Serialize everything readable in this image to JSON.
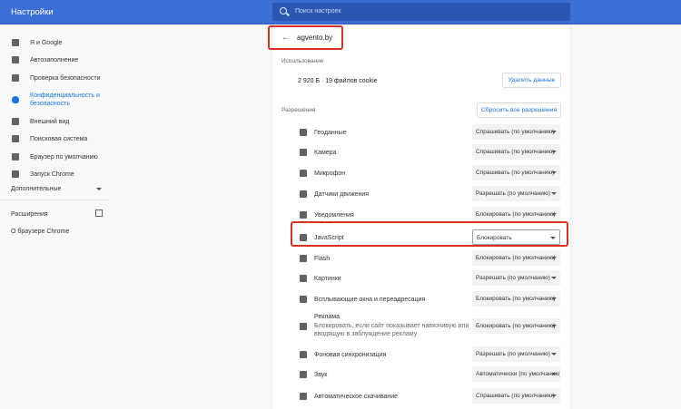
{
  "header": {
    "title": "Настройки",
    "search_placeholder": "Поиск настроек"
  },
  "sidebar": {
    "items": [
      {
        "label": "Я и Google",
        "icon": "person-icon"
      },
      {
        "label": "Автозаполнение",
        "icon": "clipboard-icon"
      },
      {
        "label": "Проверка безопасности",
        "icon": "shield-check-icon"
      },
      {
        "label": "Конфиденциальность и безопасность",
        "icon": "shield-icon",
        "active": true
      },
      {
        "label": "Внешний вид",
        "icon": "palette-icon"
      },
      {
        "label": "Поисковая система",
        "icon": "search-icon"
      },
      {
        "label": "Браузер по умолчанию",
        "icon": "browser-icon"
      },
      {
        "label": "Запуск Chrome",
        "icon": "power-icon"
      }
    ],
    "advanced": "Дополнительные",
    "extensions": "Расширения",
    "about": "О браузере Chrome"
  },
  "site": {
    "name": "agvento.by",
    "usage_heading": "Использование",
    "usage": "2 920 Б · 19 файлов cookie",
    "clear_button": "Удалить данные",
    "permissions_heading": "Разрешения",
    "reset_button": "Сбросить все разрешения"
  },
  "permissions": [
    {
      "label": "Геоданные",
      "value": "Спрашивать (по умолчанию)",
      "icon": "location-icon"
    },
    {
      "label": "Камера",
      "value": "Спрашивать (по умолчанию)",
      "icon": "camera-icon"
    },
    {
      "label": "Микрофон",
      "value": "Спрашивать (по умолчанию)",
      "icon": "microphone-icon"
    },
    {
      "label": "Датчики движения",
      "value": "Разрешать (по умолчанию)",
      "icon": "sensors-icon"
    },
    {
      "label": "Уведомления",
      "value": "Блокировать (по умолчанию)",
      "icon": "bell-icon"
    },
    {
      "label": "JavaScript",
      "value": "Блокировать",
      "icon": "code-icon"
    },
    {
      "label": "Flash",
      "value": "Блокировать (по умолчанию)",
      "icon": "puzzle-icon"
    },
    {
      "label": "Картинки",
      "value": "Разрешать (по умолчанию)",
      "icon": "image-icon"
    },
    {
      "label": "Всплывающие окна и переадресация",
      "value": "Блокировать (по умолчанию)",
      "icon": "popup-icon"
    },
    {
      "label": "Реклама",
      "sub": "Блокировать, если сайт показывает навязчивую или вводящую в заблуждение рекламу",
      "value": "Блокировать (по умолчанию)",
      "icon": "ads-icon"
    },
    {
      "label": "Фоновая синхронизация",
      "value": "Разрешать (по умолчанию)",
      "icon": "sync-icon"
    },
    {
      "label": "Звук",
      "value": "Автоматически (по умолчанию)",
      "icon": "sound-icon"
    },
    {
      "label": "Автоматическое скачивание",
      "value": "Спрашивать (по умолчанию)",
      "icon": "download-icon"
    }
  ]
}
